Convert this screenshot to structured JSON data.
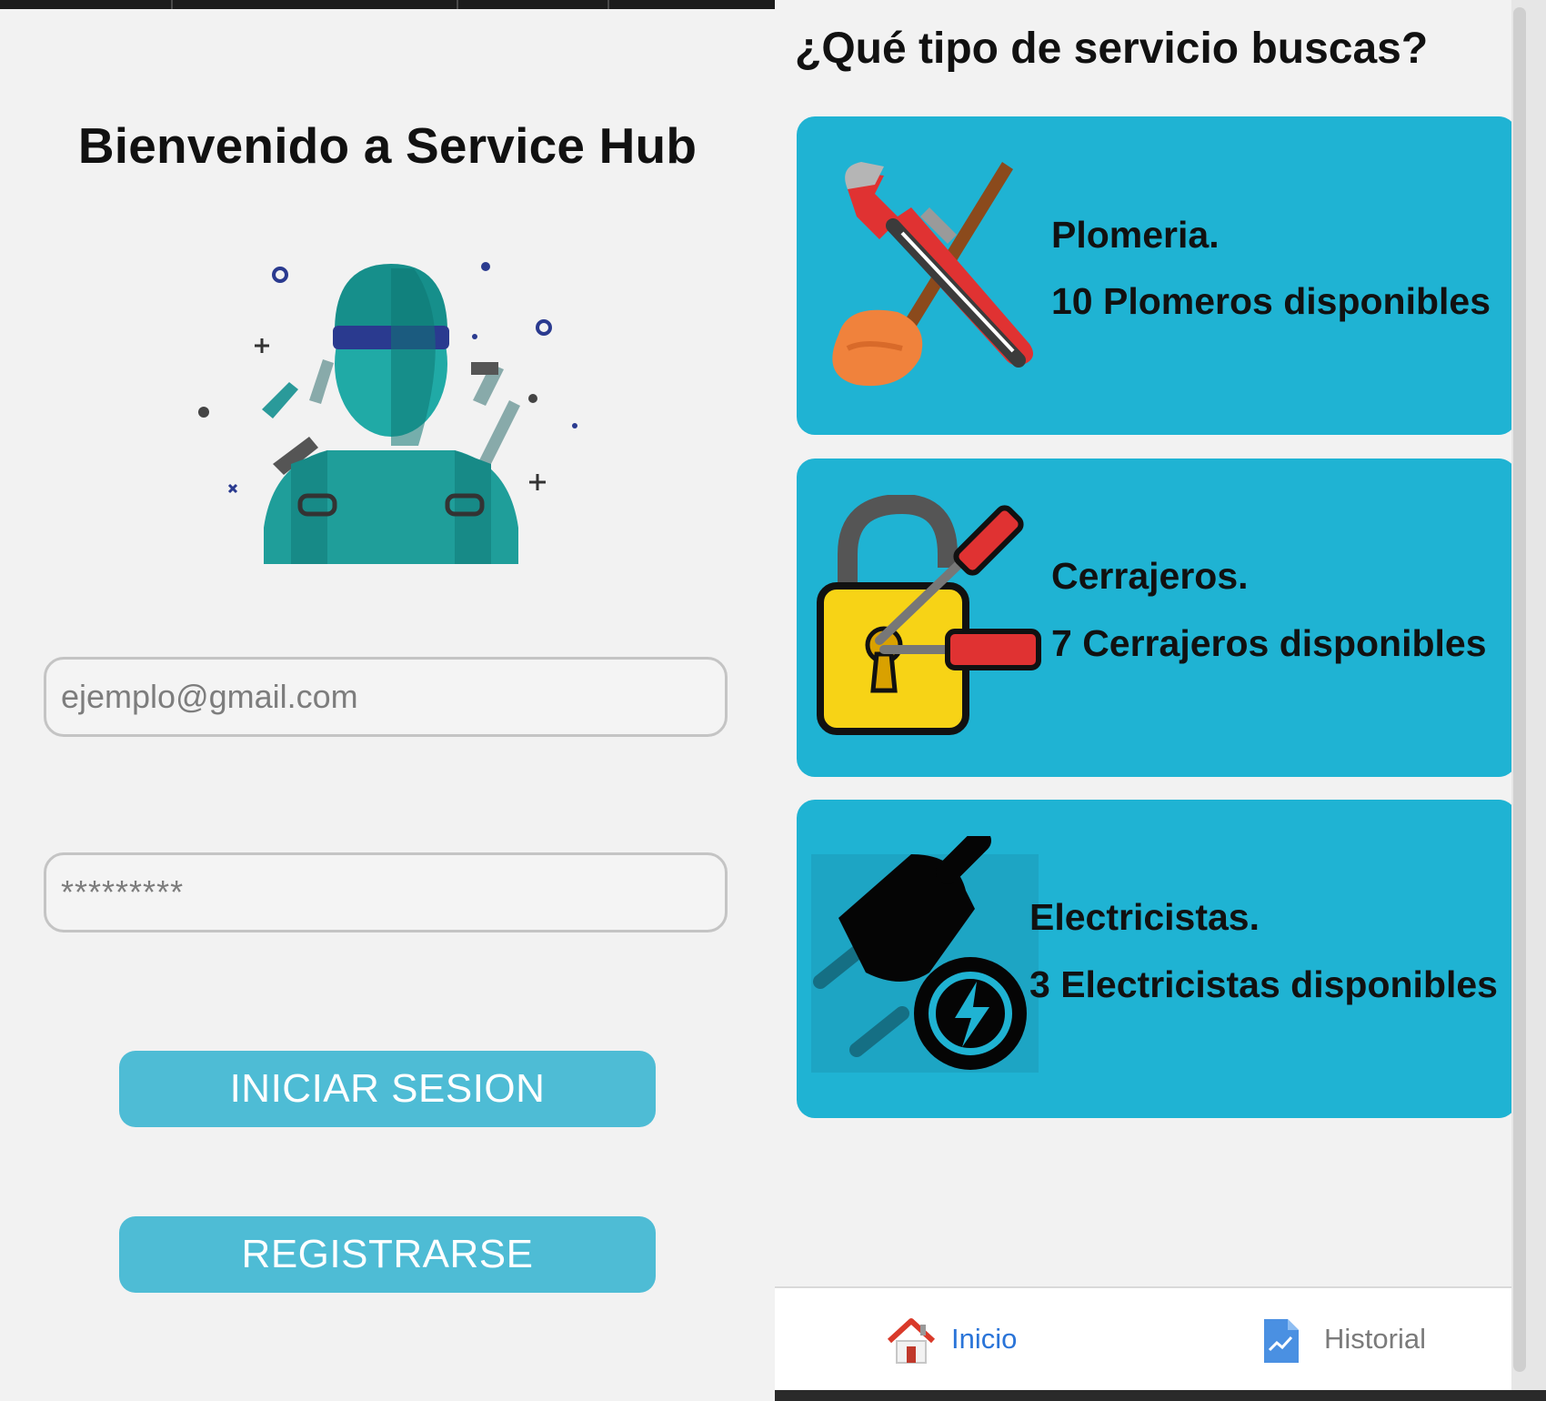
{
  "login": {
    "title": "Bienvenido a Service Hub",
    "email_placeholder": "ejemplo@gmail.com",
    "password_placeholder": "*********",
    "login_button": "INICIAR SESION",
    "register_button": "REGISTRARSE"
  },
  "services": {
    "title": "¿Qué tipo de servicio buscas?",
    "cards": [
      {
        "name": "Plomeria.",
        "count": "10 Plomeros disponibles",
        "icon": "plumbing-tools-icon"
      },
      {
        "name": "Cerrajeros.",
        "count": "7 Cerrajeros disponibles",
        "icon": "padlock-screwdriver-icon"
      },
      {
        "name": "Electricistas.",
        "count": "3 Electricistas disponibles",
        "icon": "electric-plug-icon"
      }
    ],
    "card_color": "#1fb3d3"
  },
  "nav": {
    "items": [
      {
        "label": "Inicio",
        "icon": "home-icon",
        "active": true
      },
      {
        "label": "Historial",
        "icon": "history-document-icon",
        "active": false
      }
    ],
    "active_color": "#2a74d8"
  },
  "colors": {
    "button": "#4ebcd5",
    "background": "#f2f2f2"
  }
}
